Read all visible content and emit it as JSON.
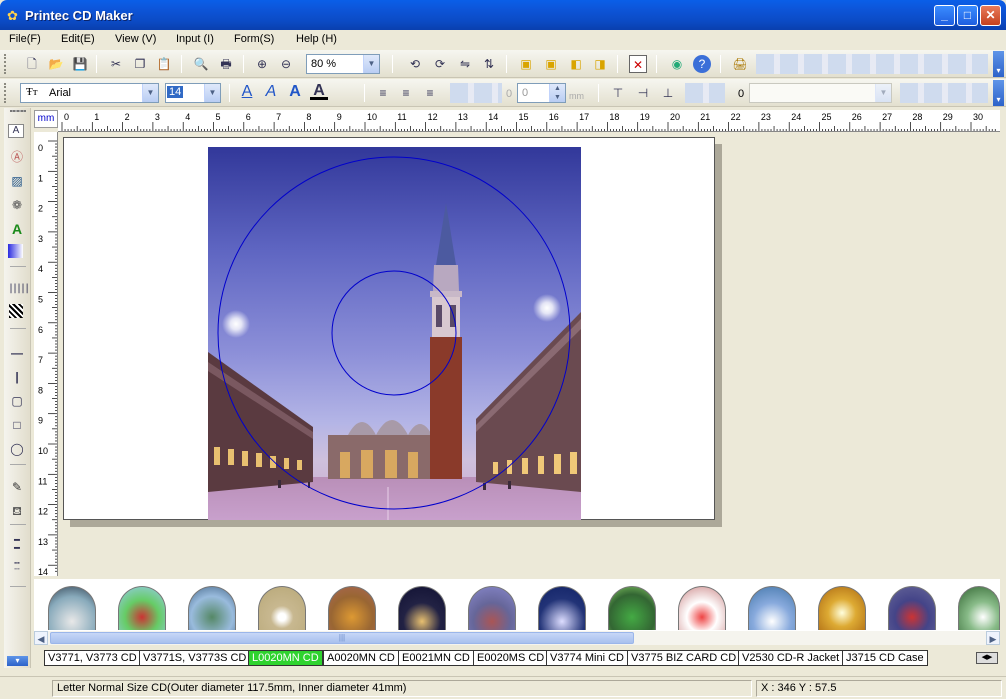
{
  "window": {
    "title": "Printec CD Maker",
    "minimize": "_",
    "maximize": "□",
    "close": "✕"
  },
  "menu": [
    "File(F)",
    "Edit(E)",
    "View (V)",
    "Input (I)",
    "Form(S)",
    "Help (H)"
  ],
  "toolbar1": {
    "zoom_value": "80 %"
  },
  "toolbar2": {
    "font_name": "Arial",
    "font_size": "14",
    "spacing_value": "0",
    "unit": "mm",
    "rotation_value": "0"
  },
  "ruler": {
    "unit_label": "mm",
    "h_ticks": [
      "0",
      "1",
      "2",
      "3",
      "4",
      "5",
      "6",
      "7",
      "8",
      "9",
      "10",
      "11",
      "12",
      "13",
      "14",
      "15",
      "16",
      "17",
      "18",
      "19",
      "20",
      "21",
      "22",
      "23",
      "24",
      "25",
      "26",
      "27",
      "28",
      "29",
      "30"
    ],
    "v_ticks": [
      "0",
      "1",
      "2",
      "3",
      "4",
      "5",
      "6",
      "7",
      "8",
      "9",
      "10",
      "11",
      "12",
      "13",
      "14"
    ]
  },
  "template_tabs": [
    "V3771, V3773 CD",
    "V3771S, V3773S CD",
    "L0020MN CD",
    "A0020MN CD",
    "E0021MN CD",
    "E0020MS CD",
    "V3774 Mini CD",
    "V3775 BIZ CARD CD",
    "V2530 CD-R Jacket",
    "J3715 CD Case"
  ],
  "active_tab": "L0020MN CD",
  "thumbnail_scroll_grip": "|||",
  "status": {
    "description": "Letter Normal Size CD(Outer diameter 117.5mm, Inner diameter 41mm)",
    "coords": "X : 346  Y : 57.5"
  },
  "colors": {
    "title_bar": "#0A5FE8",
    "active_tab": "#2fd32f",
    "disc_outline": "#0000cc"
  }
}
